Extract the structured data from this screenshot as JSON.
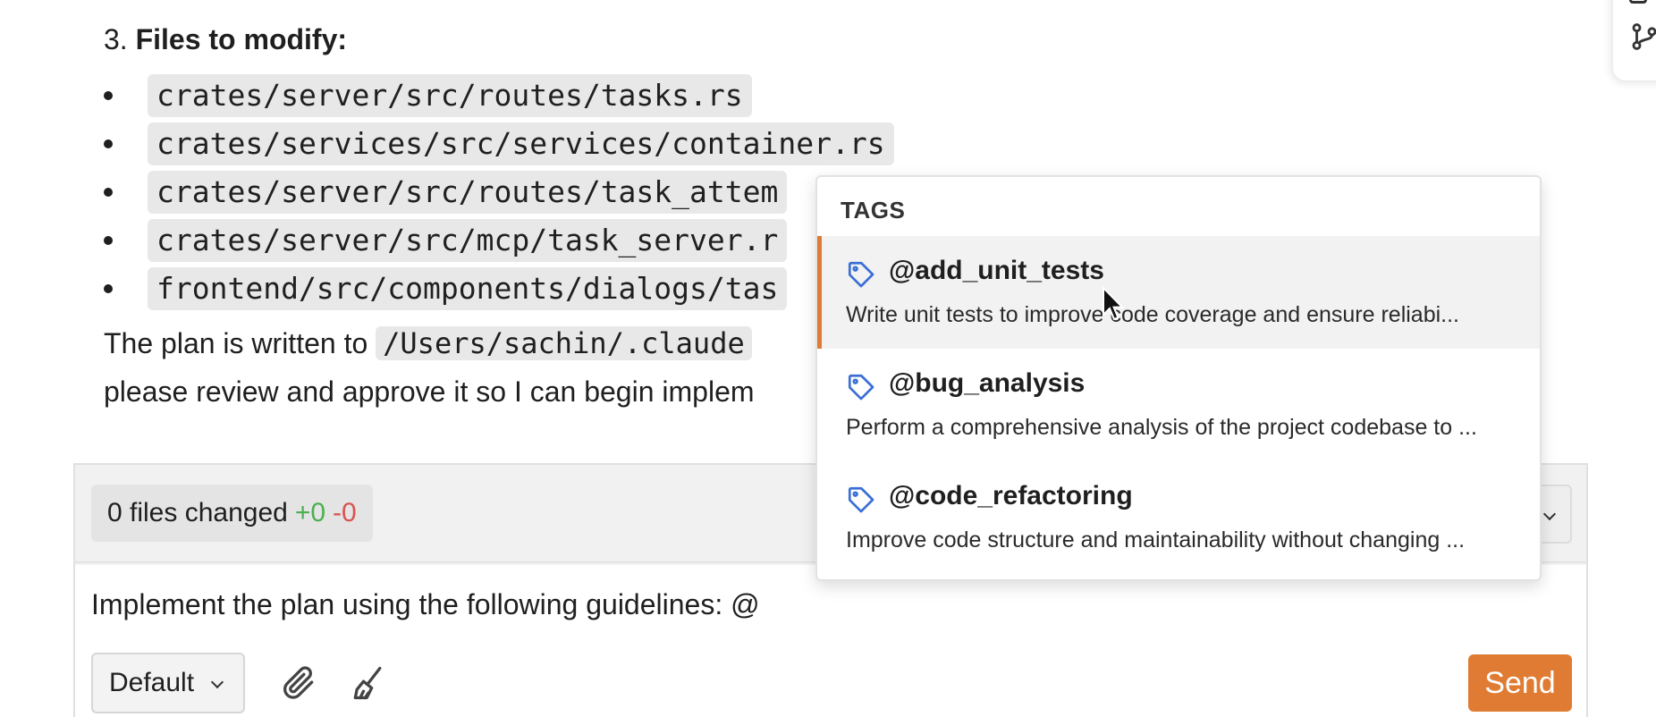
{
  "message": {
    "step_number": "3.",
    "step_title": "Files to modify:",
    "files": [
      "crates/server/src/routes/tasks.rs",
      "crates/services/src/services/container.rs",
      "crates/server/src/routes/task_attem",
      "crates/server/src/mcp/task_server.r",
      "frontend/src/components/dialogs/tas"
    ],
    "plan_prefix": "The plan is written to",
    "plan_path": "/Users/sachin/.claude",
    "plan_line2": "please review and approve it so I can begin implem"
  },
  "changes": {
    "summary": "0 files changed",
    "added": "+0",
    "removed": "-0"
  },
  "composer": {
    "input_value": "Implement the plan using the following guidelines: @",
    "mode": "Default",
    "send_label": "Send"
  },
  "tags_dropdown": {
    "heading": "TAGS",
    "items": [
      {
        "name": "@add_unit_tests",
        "description": "Write unit tests to improve code coverage and ensure reliabi...",
        "active": true
      },
      {
        "name": "@bug_analysis",
        "description": "Perform a comprehensive analysis of the project codebase to ...",
        "active": false
      },
      {
        "name": "@code_refactoring",
        "description": "Improve code structure and maintainability without changing ...",
        "active": false
      }
    ]
  },
  "icons": {
    "tag": "tag-icon",
    "attach": "paperclip-icon",
    "clear": "broom-icon",
    "branch": "git-branch-icon"
  },
  "colors": {
    "accent": "#e07b33",
    "tag_icon": "#3b6fd6",
    "added": "#4caf50",
    "removed": "#d9534f"
  }
}
